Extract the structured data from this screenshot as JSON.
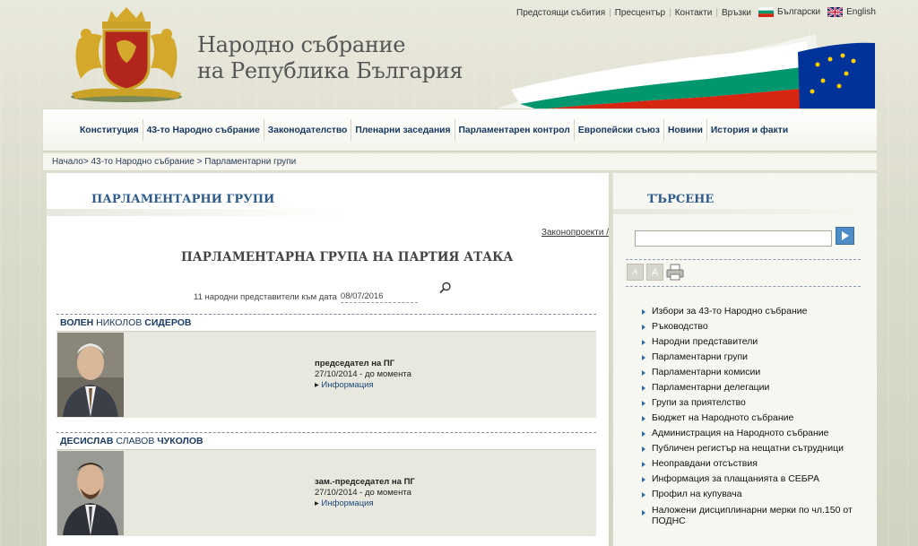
{
  "top_nav": {
    "items": [
      "Предстоящи събития",
      "Пресцентър",
      "Контакти",
      "Връзки"
    ],
    "lang_bg": "Български",
    "lang_en": "English"
  },
  "site_title": {
    "line1": "Народно събрание",
    "line2": "на Република България"
  },
  "main_nav": {
    "items": [
      "Конституция",
      "43-то Народно събрание",
      "Законодателство",
      "Пленарни заседания",
      "Парламентарен контрол",
      "Европейски съюз",
      "Новини",
      "История и факти"
    ]
  },
  "breadcrumb": {
    "text": "Начало> 43-то Народно събрание > Парламентарни групи"
  },
  "content": {
    "heading": "ПАРЛАМЕНТАРНИ ГРУПИ",
    "zakonoproekti": "Законопроекти /",
    "group_title": "ПАРЛАМЕНТАРНА ГРУПА НА ПАРТИЯ АТАКА",
    "count_text": "11 народни представители към дата",
    "date_value": "08/07/2016",
    "members": [
      {
        "first": "ВОЛЕН",
        "middle": "НИКОЛОВ",
        "last": "СИДЕРОВ",
        "role": "председател на ПГ",
        "period": "27/10/2014 - до момента",
        "info_link": "Информация"
      },
      {
        "first": "ДЕСИСЛАВ",
        "middle": "СЛАВОВ",
        "last": "ЧУКОЛОВ",
        "role": "зам.-председател на ПГ",
        "period": "27/10/2014 - до момента",
        "info_link": "Информация"
      }
    ]
  },
  "sidebar": {
    "heading": "ТЪРСЕНЕ",
    "search_value": "",
    "tools": [
      "A",
      "A"
    ],
    "links": [
      "Избори за 43-то Народно събрание",
      "Ръководство",
      "Народни представители",
      "Парламентарни групи",
      "Парламентарни комисии",
      "Парламентарни делегации",
      "Групи за приятелство",
      "Бюджет на Народното събрание",
      "Администрация на Народното събрание",
      "Публичен регистър на нещатни сътрудници",
      "Неоправдани отсъствия",
      "Информация за плащанията в СЕБРА",
      "Профил на купувача",
      "Наложени дисциплинарни мерки по чл.150 от ПОДНС"
    ]
  },
  "colors": {
    "nav_text": "#14365e",
    "heading_blue": "#2e5b8c",
    "bulgaria_white": "#ffffff",
    "bulgaria_green": "#00966e",
    "bulgaria_red": "#d62612",
    "eu_blue": "#003399",
    "eu_star": "#ffcc00"
  }
}
